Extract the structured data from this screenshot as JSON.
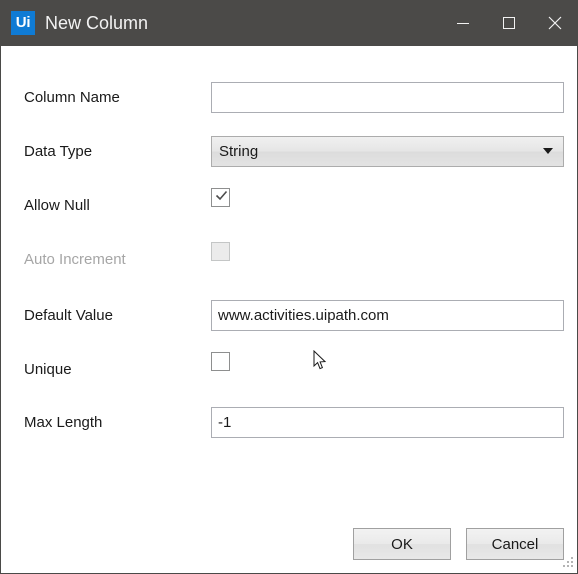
{
  "window": {
    "title": "New Column",
    "logo_text": "Ui",
    "logo_color": "#0f7bd4",
    "titlebar_color": "#4b4a48",
    "controls": [
      {
        "name": "minimize-button",
        "glyph": "minimize"
      },
      {
        "name": "maximize-button",
        "glyph": "maximize"
      },
      {
        "name": "close-button",
        "glyph": "close"
      }
    ]
  },
  "form": {
    "rows": [
      {
        "label": "Column Name",
        "control": "textbox",
        "value": "",
        "placeholder": "",
        "enabled": true
      },
      {
        "label": "Data Type",
        "control": "combobox",
        "value": "String",
        "options": [
          "String"
        ],
        "enabled": true
      },
      {
        "label": "Allow Null",
        "control": "checkbox",
        "checked": true,
        "enabled": true
      },
      {
        "label": "Auto Increment",
        "control": "checkbox",
        "checked": false,
        "enabled": false
      },
      {
        "label": "Default Value",
        "control": "textbox",
        "value": "www.activities.uipath.com",
        "placeholder": "",
        "enabled": true
      },
      {
        "label": "Unique",
        "control": "checkbox",
        "checked": false,
        "enabled": true
      },
      {
        "label": "Max Length",
        "control": "textbox",
        "value": "-1",
        "placeholder": "",
        "enabled": true
      }
    ]
  },
  "footer": {
    "ok_label": "OK",
    "cancel_label": "Cancel"
  }
}
